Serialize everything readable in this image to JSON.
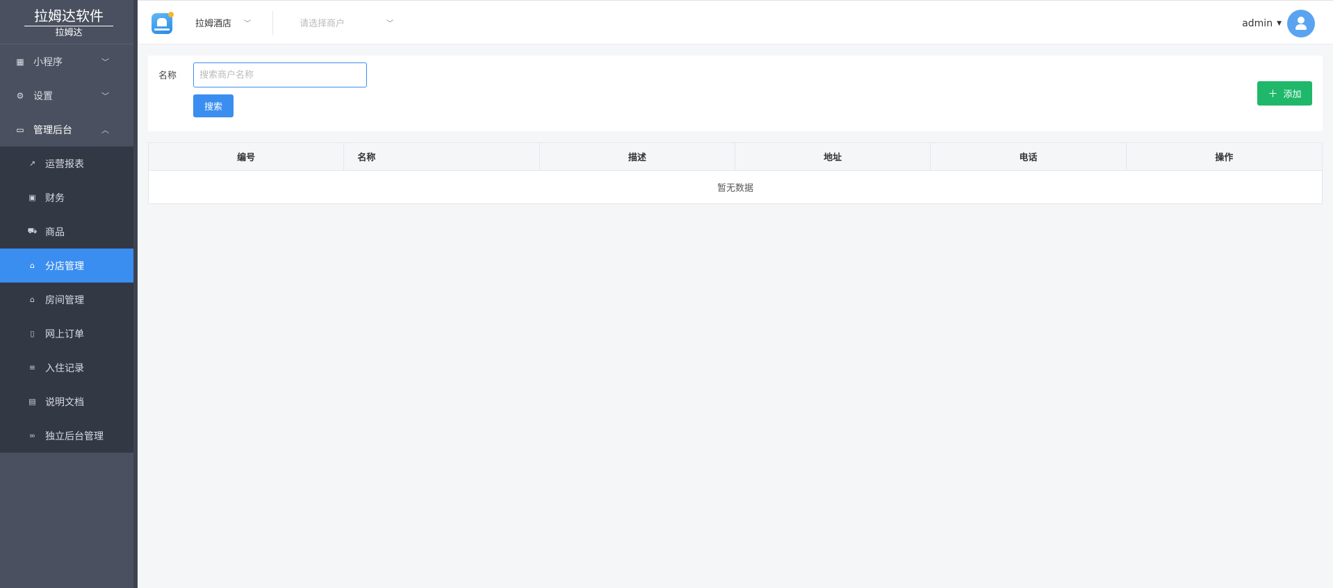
{
  "sidebar": {
    "brand_title": "拉姆达软件",
    "brand_sub": "拉姆达",
    "items": [
      {
        "label": "小程序",
        "icon": "grid-icon"
      },
      {
        "label": "设置",
        "icon": "gear-icon"
      },
      {
        "label": "管理后台",
        "icon": "monitor-icon"
      }
    ],
    "submenu": [
      {
        "label": "运营报表",
        "icon": "trend-icon"
      },
      {
        "label": "财务",
        "icon": "money-icon"
      },
      {
        "label": "商品",
        "icon": "cart-icon"
      },
      {
        "label": "分店管理",
        "icon": "home-icon"
      },
      {
        "label": "房间管理",
        "icon": "building-icon"
      },
      {
        "label": "网上订单",
        "icon": "mobile-icon"
      },
      {
        "label": "入住记录",
        "icon": "list-icon"
      },
      {
        "label": "说明文档",
        "icon": "file-icon"
      },
      {
        "label": "独立后台管理",
        "icon": "link-icon"
      }
    ],
    "active_item": "分店管理"
  },
  "header": {
    "store_select": "拉姆酒店",
    "merchant_placeholder": "请选择商户",
    "user_name": "admin"
  },
  "filter": {
    "name_label": "名称",
    "search_placeholder": "搜索商户名称",
    "search_value": "",
    "search_button": "搜索",
    "add_button": "添加"
  },
  "table": {
    "columns": [
      "编号",
      "名称",
      "描述",
      "地址",
      "电话",
      "操作"
    ],
    "rows": [],
    "empty_text": "暂无数据"
  },
  "colors": {
    "sidebar_bg": "#4a505f",
    "submenu_bg": "#333845",
    "accent": "#3a8ef0",
    "add_green": "#1fb86a"
  }
}
